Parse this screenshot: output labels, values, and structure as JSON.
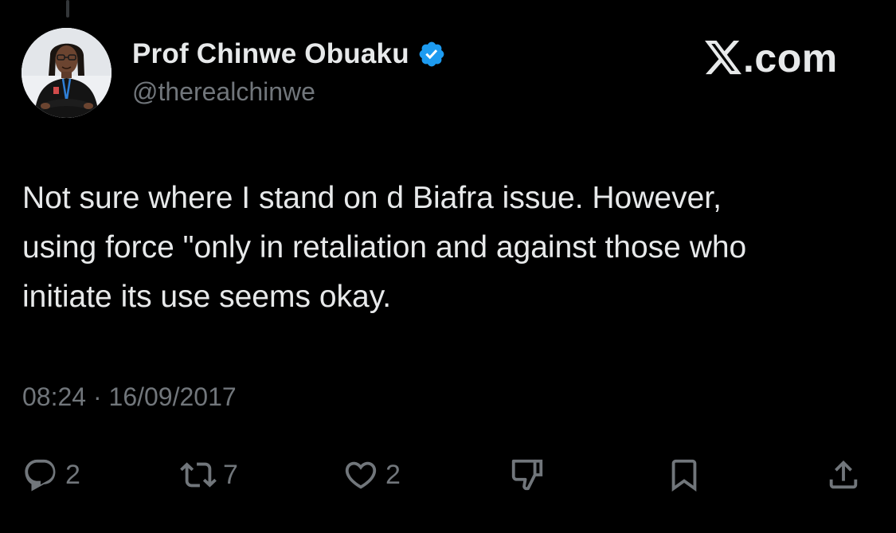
{
  "author": {
    "display_name": "Prof Chinwe Obuaku",
    "handle": "@therealchinwe",
    "verified": true
  },
  "site": {
    "text": ".com",
    "logo_icon": "x-logo-icon"
  },
  "tweet": {
    "text": "Not sure where I stand on d Biafra issue. However,\nusing force \"only in retaliation and against those who\ninitiate its use seems okay.",
    "timestamp": "08:24 · 16/09/2017"
  },
  "actions": {
    "reply_count": "2",
    "repost_count": "7",
    "like_count": "2",
    "dislike_icon": "thumbs-down-icon",
    "bookmark_icon": "bookmark-icon",
    "share_icon": "share-icon"
  },
  "colors": {
    "background": "#000000",
    "primary_text": "#e7e9ea",
    "secondary_text": "#71767b",
    "verified_badge": "#1d9bf0"
  }
}
